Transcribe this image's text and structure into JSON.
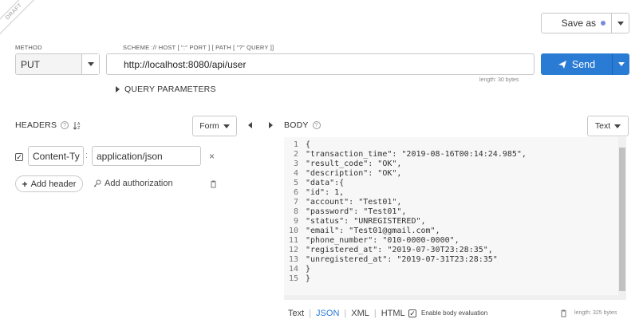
{
  "badge": "DRAFT",
  "save_as": {
    "label": "Save as",
    "dot_color": "#7b8bd9"
  },
  "method": {
    "label": "METHOD",
    "value": "PUT"
  },
  "url": {
    "label": "SCHEME :// HOST [ \":\" PORT ] [ PATH [ \"?\" QUERY ]]",
    "value": "http://localhost:8080/api/user",
    "length_note": "length: 30 bytes"
  },
  "send": {
    "label": "Send",
    "color": "#2a7bd4"
  },
  "query_params": {
    "label": "QUERY PARAMETERS"
  },
  "headers": {
    "title": "HEADERS",
    "mode": "Form",
    "items": [
      {
        "name": "Content-Ty",
        "value": "application/json",
        "checked": true
      }
    ],
    "add_header": "Add header",
    "add_auth": "Add authorization"
  },
  "body": {
    "title": "BODY",
    "mode": "Text",
    "lines": [
      "{",
      "\"transaction_time\": \"2019-08-16T00:14:24.985\",",
      "\"result_code\": \"OK\",",
      "\"description\": \"OK\",",
      "\"data\":{",
      "\"id\": 1,",
      "\"account\": \"Test01\",",
      "\"password\": \"Test01\",",
      "\"status\": \"UNREGISTERED\",",
      "\"email\": \"Test01@gmail.com\",",
      "\"phone_number\": \"010-0000-0000\",",
      "\"registered_at\": \"2019-07-30T23:28:35\",",
      "\"unregistered_at\": \"2019-07-31T23:28:35\"",
      "}",
      "}"
    ],
    "formats": [
      "Text",
      "JSON",
      "XML",
      "HTML"
    ],
    "active_format": "JSON",
    "enable_eval": "Enable body evaluation",
    "length_note": "length: 325 bytes"
  }
}
